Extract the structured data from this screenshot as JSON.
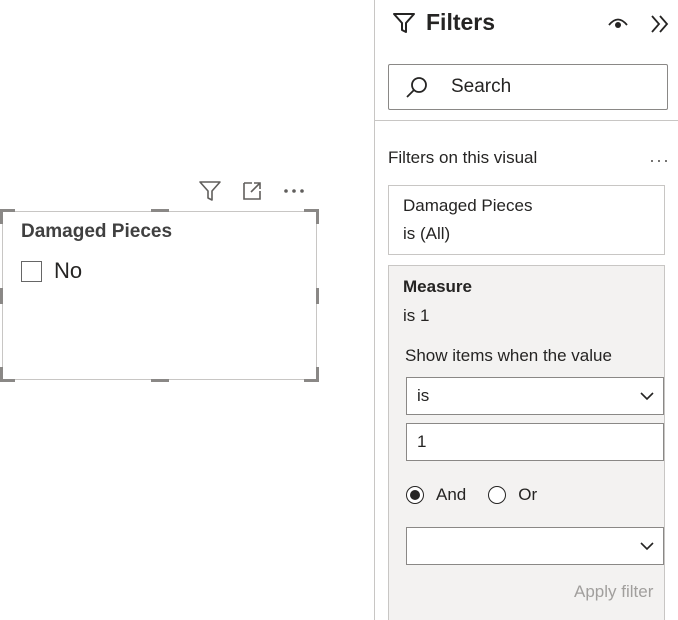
{
  "visual": {
    "title": "Damaged Pieces",
    "items": [
      {
        "label": "No",
        "checked": false
      }
    ],
    "header_icons": [
      "filter-icon",
      "focus-mode-icon",
      "more-options-icon"
    ],
    "more_options": "⋯"
  },
  "filter_pane": {
    "title": "Filters",
    "search_placeholder": "Search",
    "section_label": "Filters on this visual",
    "section_more": "···",
    "filters": [
      {
        "field": "Damaged Pieces",
        "condition": "is (All)"
      },
      {
        "field": "Measure",
        "condition": "is 1",
        "show_items_label": "Show items when the value",
        "operator": "is",
        "value": "1",
        "logic_options": [
          "And",
          "Or"
        ],
        "logic_selected": "And",
        "second_operator": "",
        "apply_label": "Apply filter"
      }
    ]
  },
  "colors": {
    "border": "#c8c6c4",
    "card_bg": "#f3f2f1",
    "text": "#252423",
    "disabled_text": "#a19f9d"
  }
}
